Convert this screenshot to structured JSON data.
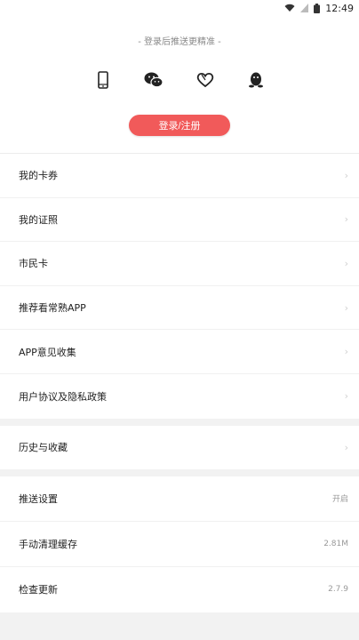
{
  "status": {
    "time": "12:49"
  },
  "header": {
    "subtitle": "- 登录后推送更精准 -",
    "social_icons": [
      "phone-icon",
      "wechat-icon",
      "heart-icon",
      "qq-icon"
    ],
    "login_label": "登录/注册",
    "accent_color": "#f15a5a"
  },
  "menu": {
    "group1": [
      {
        "label": "我的卡券"
      },
      {
        "label": "我的证照"
      },
      {
        "label": "市民卡"
      },
      {
        "label": "推荐看常熟APP"
      },
      {
        "label": "APP意见收集"
      },
      {
        "label": "用户协议及隐私政策"
      }
    ],
    "group2": [
      {
        "label": "历史与收藏"
      }
    ],
    "group3": [
      {
        "label": "推送设置",
        "value": "开启"
      },
      {
        "label": "手动清理缓存",
        "value": "2.81M"
      },
      {
        "label": "检查更新",
        "value": "2.7.9"
      }
    ]
  }
}
